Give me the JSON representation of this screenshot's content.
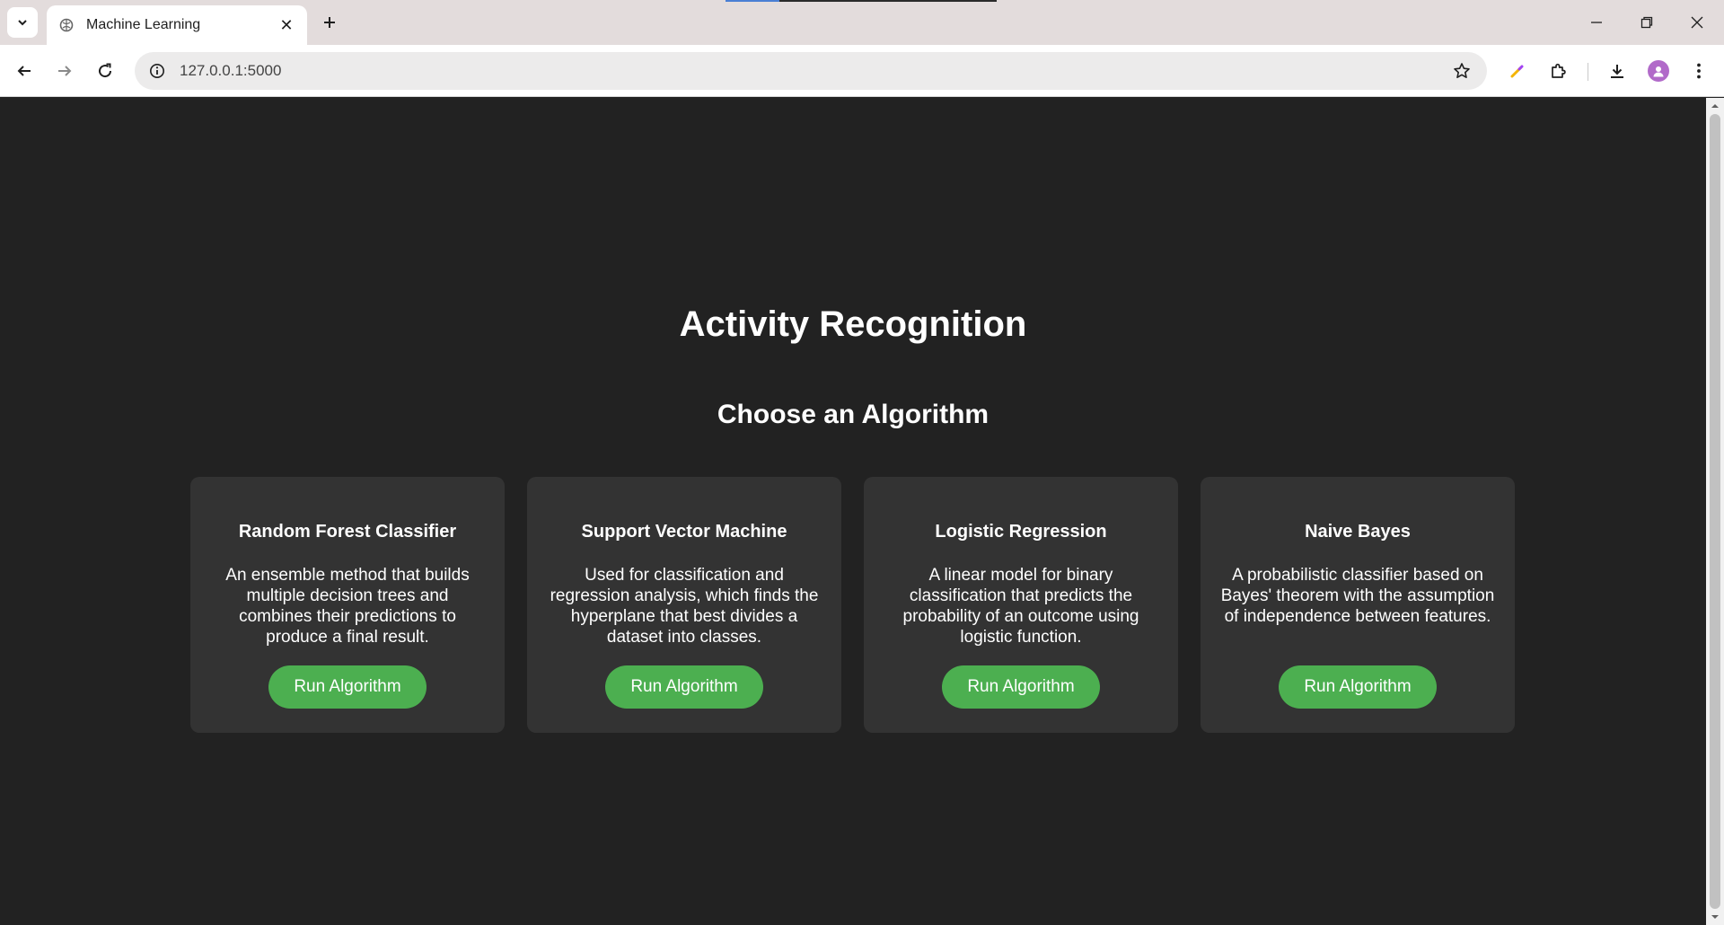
{
  "browser": {
    "tab_title": "Machine Learning",
    "url": "127.0.0.1:5000"
  },
  "page": {
    "title": "Activity Recognition",
    "subtitle": "Choose an Algorithm"
  },
  "cards": [
    {
      "title": "Random Forest Classifier",
      "description": "An ensemble method that builds multiple decision trees and combines their predictions to produce a final result.",
      "button": "Run Algorithm"
    },
    {
      "title": "Support Vector Machine",
      "description": "Used for classification and regression analysis, which finds the hyperplane that best divides a dataset into classes.",
      "button": "Run Algorithm"
    },
    {
      "title": "Logistic Regression",
      "description": "A linear model for binary classification that predicts the probability of an outcome using logistic function.",
      "button": "Run Algorithm"
    },
    {
      "title": "Naive Bayes",
      "description": "A probabilistic classifier based on Bayes' theorem with the assumption of independence between features.",
      "button": "Run Algorithm"
    }
  ],
  "colors": {
    "page_background": "#222222",
    "card_background": "#333333",
    "button_green": "#4caf50",
    "text": "#ffffff"
  },
  "icons": {
    "tab_search": "chevron-down-icon",
    "favicon": "brain-icon",
    "site_info": "info-icon",
    "bookmark": "star-icon",
    "extensions": "puzzle-icon",
    "downloads": "download-icon",
    "menu": "kebab-menu-icon"
  }
}
